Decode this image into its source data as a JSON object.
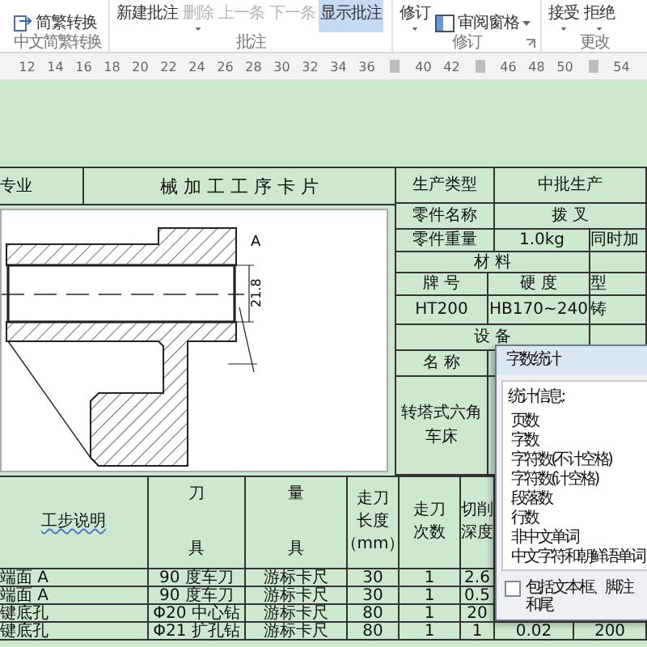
{
  "ribbon": {
    "groups": [
      {
        "label": "中文简繁转换",
        "launcher": false,
        "buttons": [
          {
            "kind": "icon",
            "label": "简繁转换",
            "dropdown": false,
            "disabled": false,
            "on": false
          }
        ]
      },
      {
        "label": "批注",
        "launcher": false,
        "buttons": [
          {
            "kind": "text",
            "label": "新建批注",
            "dropdown": false,
            "disabled": false,
            "on": false
          },
          {
            "kind": "text",
            "label": "删除",
            "dropdown": true,
            "disabled": true,
            "on": false
          },
          {
            "kind": "text",
            "label": "上一条",
            "dropdown": false,
            "disabled": true,
            "on": false
          },
          {
            "kind": "text",
            "label": "下一条",
            "dropdown": false,
            "disabled": true,
            "on": false
          },
          {
            "kind": "text",
            "label": "显示批注",
            "dropdown": false,
            "disabled": false,
            "on": true
          }
        ]
      },
      {
        "label": "修订",
        "launcher": true,
        "buttons": [
          {
            "kind": "text",
            "label": "修订",
            "dropdown": true,
            "disabled": false,
            "on": false
          },
          {
            "kind": "icon",
            "label": "审阅窗格",
            "dropdown": true,
            "disabled": false,
            "on": false
          }
        ]
      },
      {
        "label": "更改",
        "launcher": false,
        "buttons": [
          {
            "kind": "text",
            "label": "接受",
            "dropdown": true,
            "disabled": false,
            "on": false
          },
          {
            "kind": "text",
            "label": "拒绝",
            "dropdown": true,
            "disabled": false,
            "on": false
          }
        ]
      }
    ]
  },
  "ruler": {
    "ticks": [
      {
        "kind": "number",
        "label": "12"
      },
      {
        "kind": "number",
        "label": "14"
      },
      {
        "kind": "number",
        "label": "16"
      },
      {
        "kind": "number",
        "label": "18"
      },
      {
        "kind": "number",
        "label": "20"
      },
      {
        "kind": "number",
        "label": "22"
      },
      {
        "kind": "number",
        "label": "24"
      },
      {
        "kind": "number",
        "label": "26"
      },
      {
        "kind": "number",
        "label": "28"
      },
      {
        "kind": "number",
        "label": "30"
      },
      {
        "kind": "number",
        "label": "32"
      },
      {
        "kind": "number",
        "label": "34"
      },
      {
        "kind": "number",
        "label": "36"
      },
      {
        "kind": "marker"
      },
      {
        "kind": "number",
        "label": "40"
      },
      {
        "kind": "number",
        "label": "42"
      },
      {
        "kind": "marker"
      },
      {
        "kind": "number",
        "label": "46"
      },
      {
        "kind": "number",
        "label": "48"
      },
      {
        "kind": "number",
        "label": "50"
      },
      {
        "kind": "marker"
      },
      {
        "kind": "number",
        "label": "54"
      }
    ]
  },
  "card": {
    "specialty": "专业",
    "title": "械 加 工 工 序 卡 片",
    "drawing": {
      "datum": "A",
      "dimension": "21.8"
    },
    "production_type": {
      "label": "生产类型",
      "value": "中批生产"
    },
    "part_name": {
      "label": "零件名称",
      "value": "拨 叉"
    },
    "part_weight": {
      "label": "零件重量",
      "value": "1.0kg",
      "column_3": "同时加"
    },
    "material": {
      "label": "材 料",
      "columns": [
        "牌 号",
        "硬 度",
        "型"
      ],
      "values": [
        "HT200",
        "HB170~240",
        "铸"
      ]
    },
    "equipment": {
      "label": "设 备",
      "columns": [
        "名 称"
      ],
      "values": [
        "转塔式六角车床"
      ]
    }
  },
  "steps": {
    "columns": [
      [
        "工步说明"
      ],
      [
        "刀",
        "具"
      ],
      [
        "量",
        "具"
      ],
      [
        "走刀",
        "长度",
        "（mm）"
      ],
      [
        "走刀",
        "次数"
      ],
      [
        "切削",
        "深度"
      ]
    ],
    "rows": [
      {
        "description": "端面 A",
        "tool": "90 度车刀",
        "gauge": "游标卡尺",
        "length": "30",
        "passes": "1",
        "depth": "2.6"
      },
      {
        "description": "端面 A",
        "tool": "90 度车刀",
        "gauge": "游标卡尺",
        "length": "30",
        "passes": "1",
        "depth": "0.5"
      },
      {
        "description": "键底孔",
        "tool": "Φ20 中心钻",
        "gauge": "游标卡尺",
        "length": "80",
        "passes": "1",
        "depth": "20"
      },
      {
        "description": "键底孔",
        "tool": "Φ21 扩孔钻",
        "gauge": "游标卡尺",
        "length": "80",
        "passes": "1",
        "depth": "1",
        "feed": "0.02",
        "speed": "200"
      }
    ]
  },
  "word_count_dialog": {
    "title": "字数统计",
    "heading": "统计信息:",
    "stats": [
      "页数",
      "字数",
      "字符数(不计空格)",
      "字符数(计空格)",
      "段落数",
      "行数",
      "非中文单词",
      "中文字符和朝鲜语单词"
    ],
    "include_textboxes": {
      "label": "包括文本框、脚注和尾",
      "checked": false
    }
  }
}
